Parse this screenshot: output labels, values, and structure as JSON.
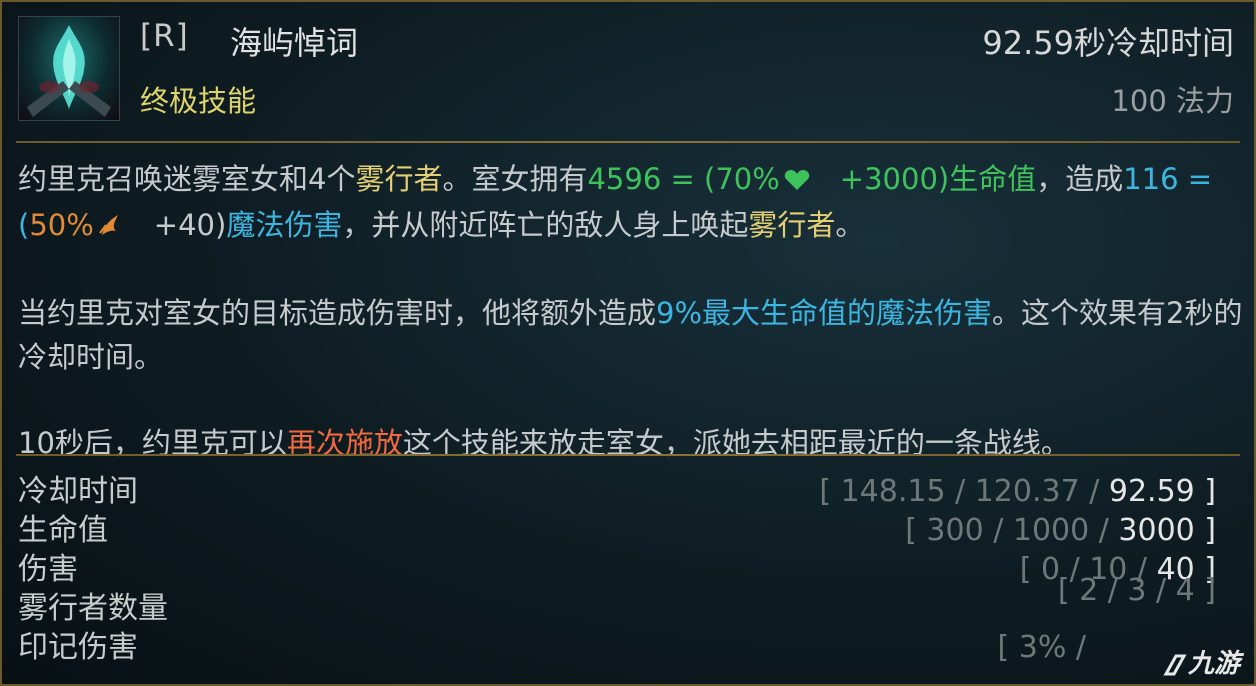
{
  "ability": {
    "key": "[R]",
    "name": "海屿悼词",
    "type": "终极技能",
    "cooldown": "92.59秒冷却时间",
    "cost": "100 法力"
  },
  "description": {
    "p1_a": "约里克召唤迷雾室女和4个",
    "p1_b": "雾行者",
    "p1_c": "。室女拥有",
    "p1_d": "4596 = (70%",
    "p1_e": "+3000)生命值",
    "p1_f": "，造成",
    "p1_g": "116 = (",
    "p1_h": "50%",
    "p1_i": "+40)",
    "p1_j": "魔法伤害",
    "p1_k": "，并从附近阵亡的敌人身上唤起",
    "p1_l": "雾行者",
    "p1_m": "。",
    "p2_a": "当约里克对室女的目标造成伤害时，他将额外造成",
    "p2_b": "9%最大生命值的魔法伤害",
    "p2_c": "。这个效果有2秒的冷却时间。",
    "p3_a": "10秒后，约里克可以",
    "p3_b": "再次施放",
    "p3_c": "这个技能来放走室女，派她去相距最近的一条战线。"
  },
  "stats": [
    {
      "label": "冷却时间",
      "low": "[ 148.15 / 120.37 / ",
      "high": "92.59 ]"
    },
    {
      "label": "生命值",
      "low": "[ 300 / 1000 / ",
      "high": "3000 ]"
    },
    {
      "label": "伤害",
      "low": "[ 0 / 10 / ",
      "high": "40 ]"
    },
    {
      "label": "雾行者数量",
      "low": "[ 2 / 3 / 4 ]",
      "high": ""
    },
    {
      "label": "印记伤害",
      "low": "[ 3% / ",
      "high": ""
    }
  ],
  "icons": [
    "ability-icon",
    "heart-icon",
    "ability-power-icon"
  ],
  "colors": {
    "gold": "#e4cf72",
    "green": "#3ec35c",
    "blue": "#3bb6e0",
    "orange": "#e08a36",
    "red": "#f06a3e",
    "border": "#6b5a2e"
  },
  "watermark": "九游"
}
